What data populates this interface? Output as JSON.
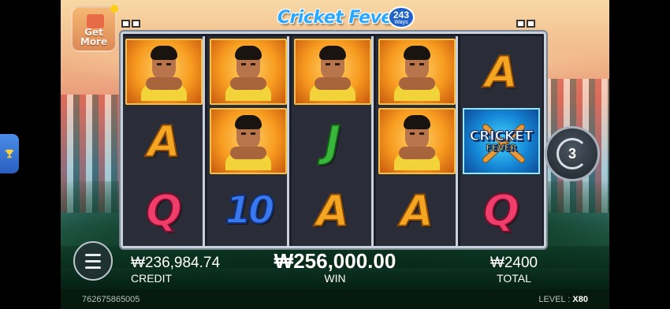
{
  "game": {
    "title": "Cricket Fever",
    "ways_number": "243",
    "ways_label": "Ways"
  },
  "get_more": {
    "label_line1": "Get",
    "label_line2": "More"
  },
  "reels": {
    "col1": [
      "player",
      "A",
      "Q"
    ],
    "col2": [
      "player",
      "player",
      "10"
    ],
    "col3": [
      "player",
      "J",
      "A"
    ],
    "col4": [
      "player",
      "player",
      "A"
    ],
    "col5": [
      "A",
      "wild",
      "Q"
    ]
  },
  "wild": {
    "line1": "CRICKET",
    "line2": "FEVER"
  },
  "spin": {
    "auto_spins_remaining": "3"
  },
  "stats": {
    "credit_value": "₩236,984.74",
    "credit_label": "CREDIT",
    "win_value": "₩256,000.00",
    "win_label": "WIN",
    "total_value": "₩2400",
    "total_label": "TOTAL"
  },
  "footer": {
    "session_id": "762675865005",
    "level_label": "LEVEL :",
    "level_value": "X80"
  },
  "icons": {
    "side_tab": "trophy-icon",
    "menu": "hamburger-menu-icon",
    "spin": "spin-arrow-icon"
  }
}
